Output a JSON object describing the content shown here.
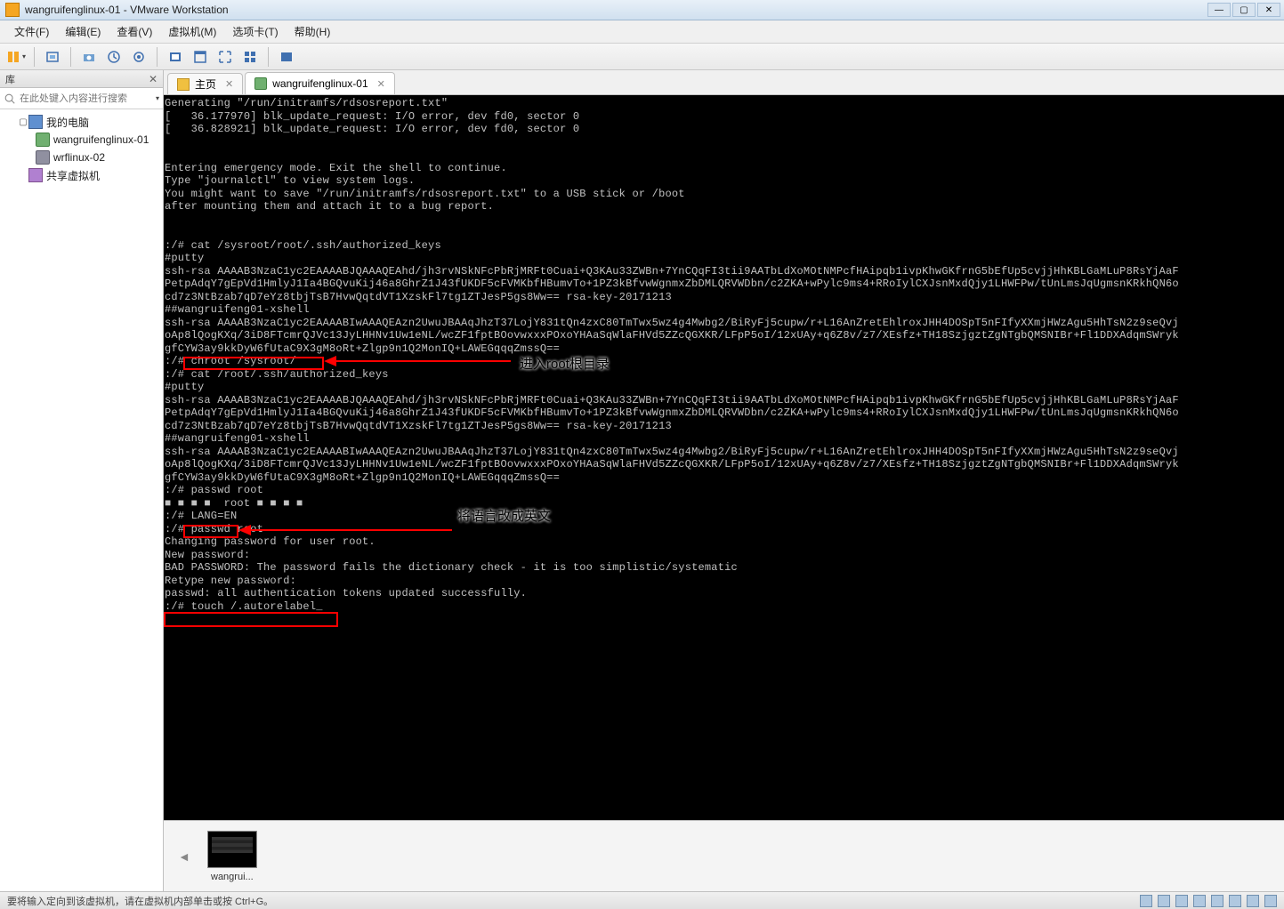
{
  "window": {
    "title": "wangruifenglinux-01 - VMware Workstation"
  },
  "menu": {
    "file": "文件(F)",
    "edit": "编辑(E)",
    "view": "查看(V)",
    "vm": "虚拟机(M)",
    "tabs": "选项卡(T)",
    "help": "帮助(H)"
  },
  "sidebar": {
    "header": "库",
    "search_placeholder": "在此处键入内容进行搜索",
    "items": {
      "my_computer": "我的电脑",
      "vm1": "wangruifenglinux-01",
      "vm2": "wrflinux-02",
      "shared": "共享虚拟机"
    }
  },
  "tabs": {
    "home": "主页",
    "vm": "wangruifenglinux-01"
  },
  "terminal": {
    "lines": "Generating \"/run/initramfs/rdsosreport.txt\"\n[   36.177970] blk_update_request: I/O error, dev fd0, sector 0\n[   36.828921] blk_update_request: I/O error, dev fd0, sector 0\n\n\nEntering emergency mode. Exit the shell to continue.\nType \"journalctl\" to view system logs.\nYou might want to save \"/run/initramfs/rdsosreport.txt\" to a USB stick or /boot\nafter mounting them and attach it to a bug report.\n\n\n:/# cat /sysroot/root/.ssh/authorized_keys\n#putty\nssh-rsa AAAAB3NzaC1yc2EAAAABJQAAAQEAhd/jh3rvNSkNFcPbRjMRFt0Cuai+Q3KAu33ZWBn+7YnCQqFI3tii9AATbLdXoMOtNMPcfHAipqb1ivpKhwGKfrnG5bEfUp5cvjjHhKBLGaMLuP8RsYjAaF\nPetpAdqY7gEpVd1HmlyJ1Ia4BGQvuKij46a8GhrZ1J43fUKDF5cFVMKbfHBumvTo+1PZ3kBfvwWgnmxZbDMLQRVWDbn/c2ZKA+wPylc9ms4+RRoIylCXJsnMxdQjy1LHWFPw/tUnLmsJqUgmsnKRkhQN6o\ncd7z3NtBzab7qD7eYz8tbjTsB7HvwQqtdVT1XzskFl7tg1ZTJesP5gs8Ww== rsa-key-20171213\n##wangruifeng01-xshell\nssh-rsa AAAAB3NzaC1yc2EAAAABIwAAAQEAzn2UwuJBAAqJhzT37LojY831tQn4zxC80TmTwx5wz4g4Mwbg2/BiRyFj5cupw/r+L16AnZretEhlroxJHH4DOSpT5nFIfyXXmjHWzAgu5HhTsN2z9seQvj\noAp8lQogKXq/3iD8FTcmrQJVc13JyLHHNv1Uw1eNL/wcZF1fptBOovwxxxPOxoYHAaSqWlaFHVd5ZZcQGXKR/LFpP5oI/12xUAy+q6Z8v/z7/XEsfz+TH18SzjgztZgNTgbQMSNIBr+Fl1DDXAdqmSWryk\ngfCYW3ay9kkDyW6fUtaC9X3gM8oRt+Zlgp9n1Q2MonIQ+LAWEGqqqZmssQ==\n:/# chroot /sysroot/\n:/# cat /root/.ssh/authorized_keys\n#putty\nssh-rsa AAAAB3NzaC1yc2EAAAABJQAAAQEAhd/jh3rvNSkNFcPbRjMRFt0Cuai+Q3KAu33ZWBn+7YnCQqFI3tii9AATbLdXoMOtNMPcfHAipqb1ivpKhwGKfrnG5bEfUp5cvjjHhKBLGaMLuP8RsYjAaF\nPetpAdqY7gEpVd1HmlyJ1Ia4BGQvuKij46a8GhrZ1J43fUKDF5cFVMKbfHBumvTo+1PZ3kBfvwWgnmxZbDMLQRVWDbn/c2ZKA+wPylc9ms4+RRoIylCXJsnMxdQjy1LHWFPw/tUnLmsJqUgmsnKRkhQN6o\ncd7z3NtBzab7qD7eYz8tbjTsB7HvwQqtdVT1XzskFl7tg1ZTJesP5gs8Ww== rsa-key-20171213\n##wangruifeng01-xshell\nssh-rsa AAAAB3NzaC1yc2EAAAABIwAAAQEAzn2UwuJBAAqJhzT37LojY831tQn4zxC80TmTwx5wz4g4Mwbg2/BiRyFj5cupw/r+L16AnZretEhlroxJHH4DOSpT5nFIfyXXmjHWzAgu5HhTsN2z9seQvj\noAp8lQogKXq/3iD8FTcmrQJVc13JyLHHNv1Uw1eNL/wcZF1fptBOovwxxxPOxoYHAaSqWlaFHVd5ZZcQGXKR/LFpP5oI/12xUAy+q6Z8v/z7/XEsfz+TH18SzjgztZgNTgbQMSNIBr+Fl1DDXAdqmSWryk\ngfCYW3ay9kkDyW6fUtaC9X3gM8oRt+Zlgp9n1Q2MonIQ+LAWEGqqqZmssQ==\n:/# passwd root\n■ ■ ■ ■  root ■ ■ ■ ■\n:/# LANG=EN\n:/# passwd root\nChanging password for user root.\nNew password:\nBAD PASSWORD: The password fails the dictionary check - it is too simplistic/systematic\nRetype new password:\npasswd: all authentication tokens updated successfully.\n:/# touch /.autorelabel_"
  },
  "annotations": {
    "a1": "进入root根目录",
    "a2": "将语言改成英文"
  },
  "thumbnail": {
    "label": "wangrui..."
  },
  "statusbar": {
    "text": "要将输入定向到该虚拟机，请在虚拟机内部单击或按 Ctrl+G。"
  }
}
